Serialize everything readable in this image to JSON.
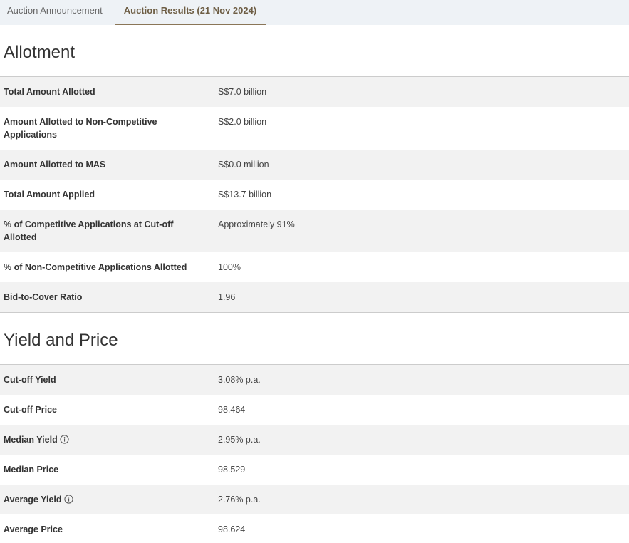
{
  "tabs": [
    {
      "label": "Auction Announcement"
    },
    {
      "label": "Auction Results (21 Nov 2024)"
    }
  ],
  "allotment": {
    "title": "Allotment",
    "rows": [
      {
        "label": "Total Amount Allotted",
        "value": "S$7.0 billion"
      },
      {
        "label": "Amount Allotted to Non-Competitive Applications",
        "value": "S$2.0 billion"
      },
      {
        "label": "Amount Allotted to MAS",
        "value": "S$0.0 million"
      },
      {
        "label": "Total Amount Applied",
        "value": "S$13.7 billion"
      },
      {
        "label": "% of Competitive Applications at Cut-off Allotted",
        "value": "Approximately 91%"
      },
      {
        "label": "% of Non-Competitive Applications Allotted",
        "value": "100%"
      },
      {
        "label": "Bid-to-Cover Ratio",
        "value": "1.96"
      }
    ]
  },
  "yield_price": {
    "title": "Yield and Price",
    "rows": [
      {
        "label": "Cut-off Yield",
        "value": "3.08% p.a."
      },
      {
        "label": "Cut-off Price",
        "value": "98.464"
      },
      {
        "label": "Median Yield",
        "value": "2.95% p.a.",
        "icon": "info-icon"
      },
      {
        "label": "Median Price",
        "value": "98.529"
      },
      {
        "label": "Average Yield",
        "value": "2.76% p.a.",
        "icon": "info-icon"
      },
      {
        "label": "Average Price",
        "value": "98.624"
      }
    ]
  }
}
